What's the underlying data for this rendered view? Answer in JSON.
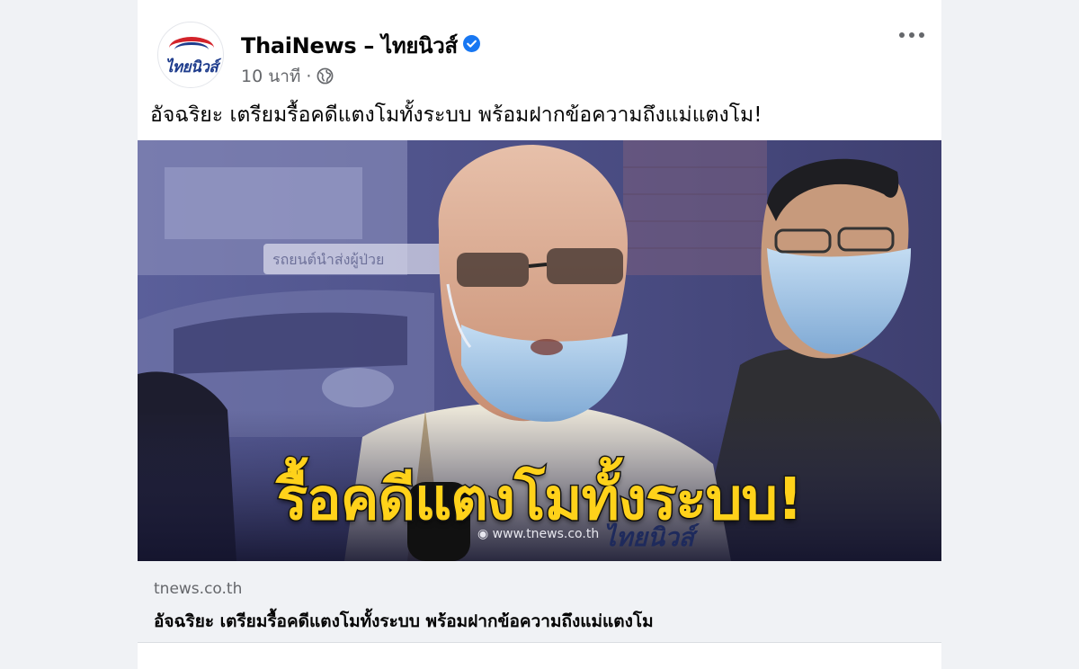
{
  "post": {
    "page_name": "ThaiNews – ไทยนิวส์",
    "verified_icon": "verified-badge-icon",
    "time": "10 นาที",
    "separator": "·",
    "audience_icon": "globe-icon",
    "more_icon": "more-options-icon",
    "text": "อัจฉริยะ เตรียมรื้อคดีแตงโมทั้งระบบ พร้อมฝากข้อความถึงแม่แตงโม!",
    "avatar_logo_text": "ไทยนิวส์"
  },
  "image": {
    "headline": "รื้อคดีแตงโมทั้งระบบ!",
    "watermark_url": "www.tnews.co.th",
    "watermark_logo": "ไทยนิวส์",
    "background_sign": "รถยนต์นำส่งผู้ป่วย"
  },
  "link": {
    "domain": "tnews.co.th",
    "title": "อัจฉริยะ เตรียมรื้อคดีแตงโมทั้งระบบ พร้อมฝากข้อความถึงแม่แตงโม"
  },
  "colors": {
    "verified": "#1877f2",
    "headline_fill": "#ffd21a",
    "headline_stroke": "#1b1b1b",
    "background": "#f0f2f5"
  }
}
